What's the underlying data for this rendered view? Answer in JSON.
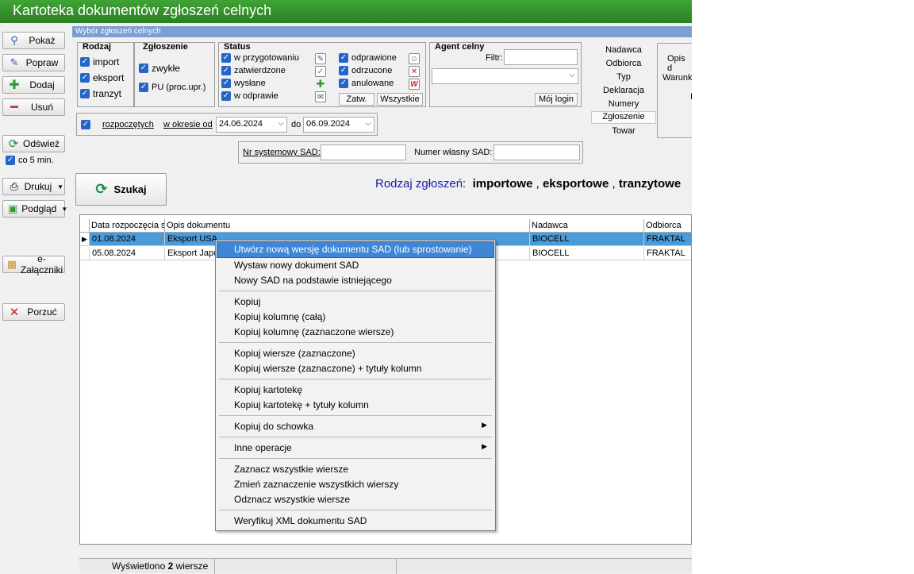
{
  "window": {
    "title": "Kartoteka dokumentów zgłoszeń celnych"
  },
  "toolbar": {
    "pokaz": "Pokaż",
    "popraw": "Popraw",
    "dodaj": "Dodaj",
    "usun": "Usuń",
    "odswiez": "Odśwież",
    "co5": "co 5 min.",
    "drukuj": "Drukuj",
    "podglad": "Podgląd",
    "ezal": "e-Załączniki",
    "porzuc": "Porzuć"
  },
  "filter": {
    "header": "Wybór zgłoszeń celnych",
    "rodzaj": {
      "title": "Rodzaj",
      "items": [
        "import",
        "eksport",
        "tranzyt"
      ]
    },
    "zgloszenie": {
      "title": "Zgłoszenie",
      "items": [
        "zwykłe",
        "PU (proc.upr.)"
      ]
    },
    "status": {
      "title": "Status",
      "left": [
        "w przygotowaniu",
        "zatwierdzone",
        "wysłane",
        "w odprawie"
      ],
      "right": [
        "odprawione",
        "odrzucone",
        "anulowane"
      ],
      "zatw_btn": "Zatw.",
      "wszystkie_btn": "Wszystkie"
    },
    "agent": {
      "title": "Agent celny",
      "filtr_label": "Filtr:",
      "filtr_value": "",
      "combo_value": "",
      "moj_login": "Mój login"
    },
    "date": {
      "type_link": "rozpoczętych",
      "range_link": "w okresie od",
      "from": "24.06.2024",
      "do_label": "do",
      "to": "06.09.2024"
    },
    "nrsys_label": "Nr systemowy SAD:",
    "nrsys_value": "",
    "nrwl_label": "Numer własny SAD:",
    "nrwl_value": ""
  },
  "side_tabs": [
    "Nadawca",
    "Odbiorca",
    "Typ",
    "Deklaracja",
    "Numery",
    "Zgłoszenie",
    "Towar"
  ],
  "right_panel": {
    "opis": "Opis d",
    "warunki": "Warunk",
    "extra": "I"
  },
  "search": {
    "button": "Szukaj"
  },
  "rodzaj_info": {
    "label": "Rodzaj zgłoszeń:",
    "imp": "importowe",
    "exp": "eksportowe",
    "tra": "tranzytowe",
    "sep": ","
  },
  "grid": {
    "headers": [
      "Data rozpoczęcia s",
      "Opis dokumentu",
      "Nadawca",
      "Odbiorca"
    ],
    "rows": [
      {
        "date": "01.08.2024",
        "opis": "Eksport USA",
        "nadawca": "BIOCELL",
        "odbiorca": "FRAKTAL"
      },
      {
        "date": "05.08.2024",
        "opis": "Eksport Japo",
        "nadawca": "BIOCELL",
        "odbiorca": "FRAKTAL"
      }
    ],
    "current_row_marker": "▶"
  },
  "status_bar": {
    "prefix": "Wyświetlono",
    "count": "2",
    "suffix": "wiersze"
  },
  "context_menu": {
    "groups": [
      [
        "Utwórz nową wersję dokumentu SAD (lub sprostowanie)",
        "Wystaw nowy dokument SAD",
        "Nowy SAD na podstawie istniejącego"
      ],
      [
        "Kopiuj",
        "Kopiuj kolumnę (całą)",
        "Kopiuj kolumnę (zaznaczone wiersze)"
      ],
      [
        "Kopiuj wiersze (zaznaczone)",
        "Kopiuj wiersze (zaznaczone) + tytuły kolumn"
      ],
      [
        "Kopiuj kartotekę",
        "Kopiuj kartotekę + tytuły kolumn"
      ],
      [
        "Kopiuj do schowka"
      ],
      [
        "Inne operacje"
      ],
      [
        "Zaznacz wszystkie wiersze",
        "Zmień zaznaczenie wszystkich wierszy",
        "Odznacz wszystkie wiersze"
      ],
      [
        "Weryfikuj XML dokumentu SAD"
      ]
    ]
  },
  "colors": {
    "title_green": "#2b7f22",
    "highlight": "#3f87d6",
    "accent_blue": "#1a1aa8"
  }
}
